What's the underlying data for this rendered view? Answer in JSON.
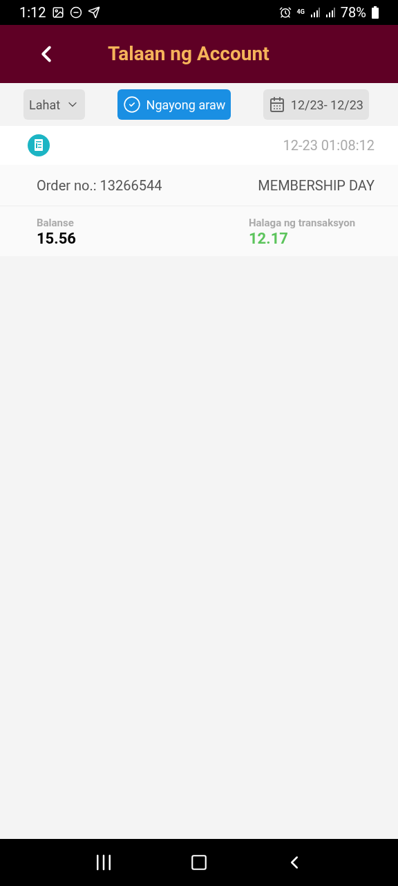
{
  "status_bar": {
    "time": "1:12",
    "network": "4G",
    "battery": "78%"
  },
  "header": {
    "title": "Talaan ng Account"
  },
  "filters": [
    {
      "kind": "dropdown",
      "label": "Lahat",
      "selected": false
    },
    {
      "kind": "check",
      "label": "Ngayong araw",
      "selected": true
    },
    {
      "kind": "date",
      "label": "12/23- 12/23",
      "selected": false
    }
  ],
  "records": [
    {
      "time": "12-23 01:08:12",
      "order": "Order no.: 13266544",
      "type": "MEMBERSHIP DAY",
      "balance_label": "Balanse",
      "balance": "15.56",
      "amount_label": "Halaga ng transaksyon",
      "amount": "12.17"
    }
  ]
}
